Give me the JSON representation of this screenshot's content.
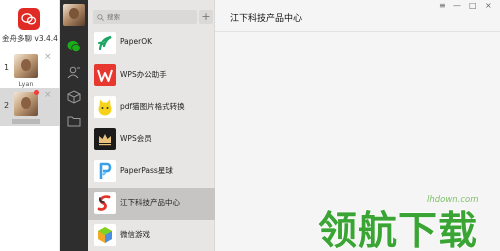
{
  "multi_panel": {
    "version": "金舟多聊 v3.4.4",
    "accounts": [
      {
        "index": "1",
        "name": "Lyan",
        "close": "×"
      },
      {
        "index": "2",
        "name": "",
        "close": "×"
      }
    ]
  },
  "chat_list": {
    "search_placeholder": "搜索",
    "add_label": "+",
    "items": [
      {
        "name": "PaperOK",
        "icon": "paperok-icon"
      },
      {
        "name": "WPS办公助手",
        "icon": "wps-icon"
      },
      {
        "name": "pdf猫图片格式转换",
        "icon": "pdfcat-icon"
      },
      {
        "name": "WPS会员",
        "icon": "wps-member-icon"
      },
      {
        "name": "PaperPass星球",
        "icon": "paperpass-icon"
      },
      {
        "name": "江下科技产品中心",
        "icon": "jiangxia-icon",
        "selected": true
      },
      {
        "name": "微信游戏",
        "icon": "wechat-game-icon"
      }
    ]
  },
  "main": {
    "title": "江下科技产品中心",
    "controls": [
      "≡",
      "—",
      "□",
      "×"
    ]
  },
  "watermark": {
    "url": "lhdown.com",
    "logo_text": "领航下载"
  },
  "colors": {
    "accent_red": "#e02b25",
    "rail_dark": "#2e2e2e",
    "wechat_green": "#1aad19",
    "chat_list_bg": "#e7e6e5",
    "selected_bg": "#c6c5c4",
    "watermark_green": "#3aa534"
  }
}
